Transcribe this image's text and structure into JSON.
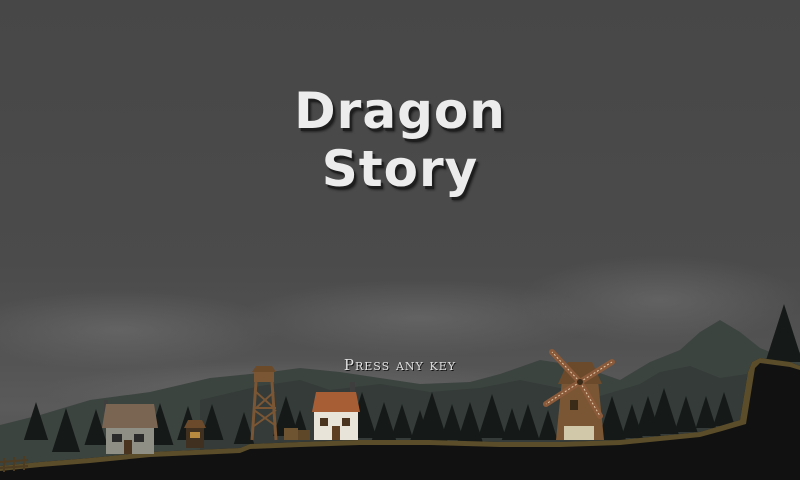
{
  "title": {
    "line1": "Dragon",
    "line2": "Story"
  },
  "prompt": "Press any key"
}
